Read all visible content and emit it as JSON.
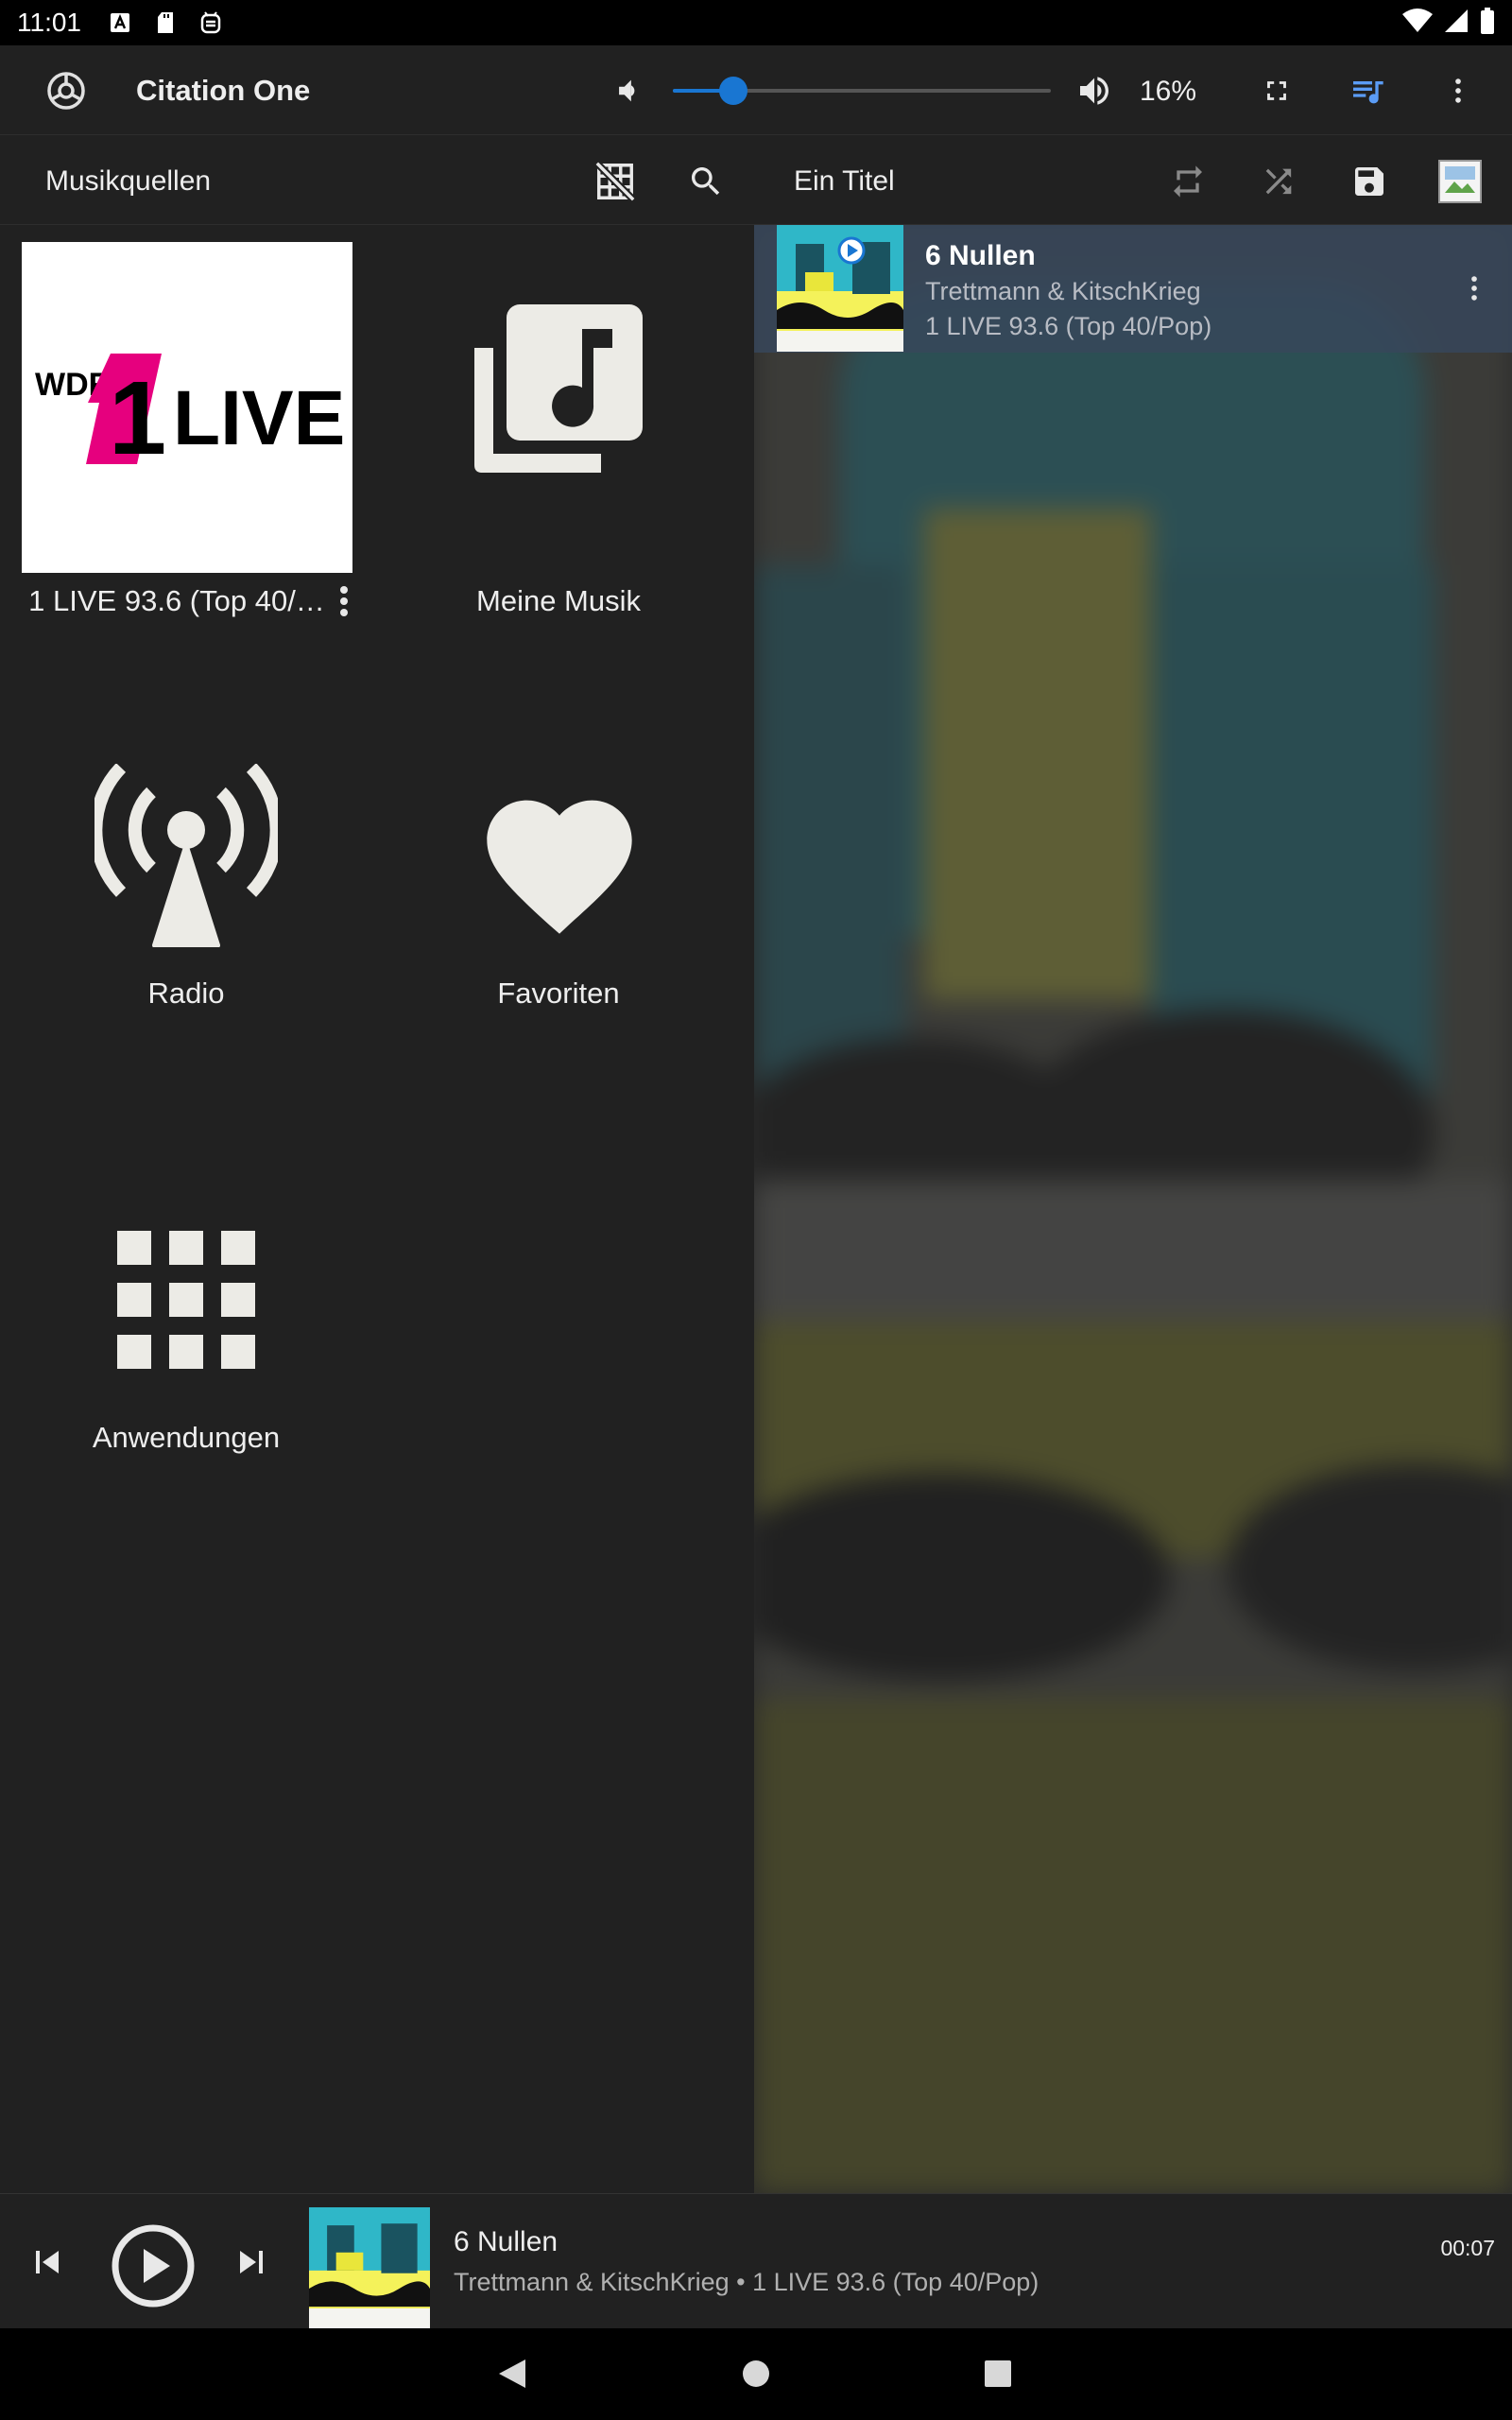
{
  "status_bar": {
    "time": "11:01",
    "left_icons": [
      "text-a-icon",
      "sd-card-icon",
      "fdroid-icon"
    ],
    "right_icons": [
      "wifi-icon",
      "signal-icon",
      "battery-icon"
    ]
  },
  "app_bar": {
    "title": "Citation One",
    "volume_percent_label": "16%",
    "volume_value": 16,
    "icons": [
      "app-logo-icon",
      "volume-down-icon",
      "volume-up-icon",
      "fullscreen-icon",
      "queue-music-icon",
      "more-vert-icon"
    ],
    "accent_color": "#1976d2"
  },
  "browser": {
    "title": "Musikquellen",
    "icons": [
      "grid-off-icon",
      "search-icon"
    ],
    "tiles": [
      {
        "label": "1 LIVE 93.6 (Top 40/…",
        "icon": "station-logo",
        "logo_text_left": "WDR",
        "logo_text_num": "1",
        "logo_text_right": "LIVE"
      },
      {
        "label": "Meine Musik",
        "icon": "library-music-icon"
      },
      {
        "label": "Radio",
        "icon": "radio-tower-icon"
      },
      {
        "label": "Favoriten",
        "icon": "heart-icon"
      },
      {
        "label": "Anwendungen",
        "icon": "apps-grid-icon"
      }
    ]
  },
  "queue": {
    "title": "Ein Titel",
    "icons": [
      "repeat-icon",
      "shuffle-icon",
      "save-icon",
      "cover-art-icon"
    ],
    "items": [
      {
        "title": "6 Nullen",
        "artist": "Trettmann & KitschKrieg",
        "station": "1 LIVE 93.6 (Top 40/Pop)"
      }
    ]
  },
  "player": {
    "title": "6 Nullen",
    "subtitle": "Trettmann & KitschKrieg • 1 LIVE 93.6 (Top 40/Pop)",
    "time": "00:07",
    "icons": [
      "skip-previous-icon",
      "play-icon",
      "skip-next-icon"
    ]
  },
  "nav_bar": {
    "icons": [
      "back-icon",
      "home-icon",
      "recents-icon"
    ]
  }
}
